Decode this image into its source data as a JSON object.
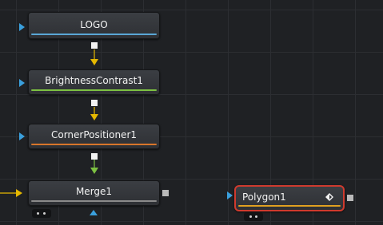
{
  "nodes": {
    "logo": {
      "label": "LOGO",
      "accent": "#5aa7d6"
    },
    "brightness": {
      "label": "BrightnessContrast1",
      "accent": "#7dc142"
    },
    "corner": {
      "label": "CornerPositioner1",
      "accent": "#d9762a"
    },
    "merge": {
      "label": "Merge1",
      "accent": "#8a8a8a"
    },
    "polygon": {
      "label": "Polygon1",
      "accent": "#e0a020",
      "selected": true
    }
  },
  "colors": {
    "canvas": "#1f2124",
    "input_triangle": "#3a9fdc",
    "wire_yellow": "#e5b800",
    "wire_green": "#7dc142",
    "selection_border": "#cf3a2e"
  },
  "icons": [
    "input-triangle-icon",
    "output-square-icon",
    "arrow-down-icon",
    "keyframe-diamond-icon",
    "toggle-icon"
  ]
}
